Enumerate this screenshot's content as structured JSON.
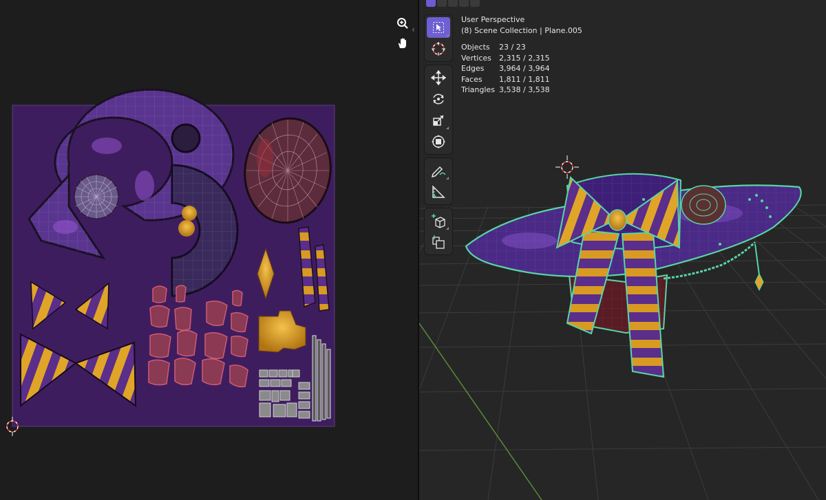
{
  "viewport": {
    "view_name": "User Perspective",
    "collection_path": "(8) Scene Collection | Plane.005",
    "stats": [
      {
        "label": "Objects",
        "value": "23 / 23"
      },
      {
        "label": "Vertices",
        "value": "2,315 / 2,315"
      },
      {
        "label": "Edges",
        "value": "3,964 / 3,964"
      },
      {
        "label": "Faces",
        "value": "1,811 / 1,811"
      },
      {
        "label": "Triangles",
        "value": "3,538 / 3,538"
      }
    ],
    "toolbar": [
      {
        "name": "select-box-tool",
        "icon": "cursor-arrow-icon",
        "active": true
      },
      {
        "name": "cursor-tool",
        "icon": "3d-cursor-icon",
        "active": false
      },
      {
        "name": "move-tool",
        "icon": "move-arrows-icon",
        "active": false
      },
      {
        "name": "rotate-tool",
        "icon": "rotate-icon",
        "active": false
      },
      {
        "name": "scale-tool",
        "icon": "scale-icon",
        "active": false
      },
      {
        "name": "transform-tool",
        "icon": "transform-icon",
        "active": false
      },
      {
        "name": "annotate-tool",
        "icon": "pencil-icon",
        "active": false
      },
      {
        "name": "measure-tool",
        "icon": "ruler-icon",
        "active": false
      },
      {
        "name": "add-cube-tool",
        "icon": "add-cube-icon",
        "active": false
      },
      {
        "name": "duplicate-tool",
        "icon": "duplicate-icon",
        "active": false
      }
    ]
  },
  "uv_editor": {
    "nav": [
      {
        "name": "zoom-button",
        "icon": "zoom-in-icon"
      },
      {
        "name": "pan-button",
        "icon": "hand-icon"
      }
    ]
  },
  "colors": {
    "uv_background": "#3e1d5f",
    "wireframe_select": "#57d6a6",
    "accent": "#6e5fd2",
    "gold": "#e0a528",
    "purple": "#5a2e9a"
  }
}
